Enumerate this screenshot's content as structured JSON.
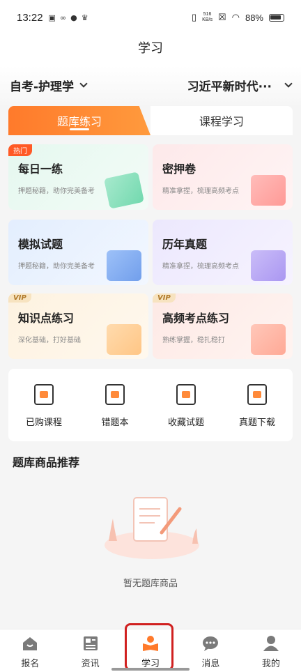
{
  "status": {
    "time": "13:22",
    "speed_top": "516",
    "speed_bottom": "KB/s",
    "battery": "88%"
  },
  "header": {
    "title": "学习"
  },
  "selector": {
    "subject": "自考-护理学",
    "course": "习近平新时代···"
  },
  "tabs": [
    {
      "label": "题库练习",
      "active": true
    },
    {
      "label": "课程学习",
      "active": false
    }
  ],
  "cards": [
    {
      "title": "每日一练",
      "subtitle": "押题秘籍，助你完美备考",
      "badge": "热门"
    },
    {
      "title": "密押卷",
      "subtitle": "精准拿捏，梳理高频考点",
      "badge": ""
    },
    {
      "title": "模拟试题",
      "subtitle": "押题秘籍，助你完美备考",
      "badge": ""
    },
    {
      "title": "历年真题",
      "subtitle": "精准拿捏，梳理高频考点",
      "badge": ""
    },
    {
      "title": "知识点练习",
      "subtitle": "深化基础，打好基础",
      "badge": "VIP"
    },
    {
      "title": "高频考点练习",
      "subtitle": "熟练掌握，稳扎稳打",
      "badge": "VIP"
    }
  ],
  "quick_links": [
    {
      "label": "已购课程",
      "icon": "book-open-icon"
    },
    {
      "label": "错题本",
      "icon": "wrong-notebook-icon"
    },
    {
      "label": "收藏试题",
      "icon": "star-book-icon"
    },
    {
      "label": "真题下载",
      "icon": "download-book-icon"
    }
  ],
  "recommend": {
    "title": "题库商品推荐",
    "empty_text": "暂无题库商品"
  },
  "bottom_nav": [
    {
      "label": "报名",
      "icon": "house-icon",
      "active": false
    },
    {
      "label": "资讯",
      "icon": "news-icon",
      "active": false
    },
    {
      "label": "学习",
      "icon": "reading-person-icon",
      "active": true
    },
    {
      "label": "消息",
      "icon": "chat-bubble-icon",
      "active": false
    },
    {
      "label": "我的",
      "icon": "user-icon",
      "active": false
    }
  ],
  "colors": {
    "accent": "#ff7a2b",
    "highlight": "#d0201f"
  }
}
